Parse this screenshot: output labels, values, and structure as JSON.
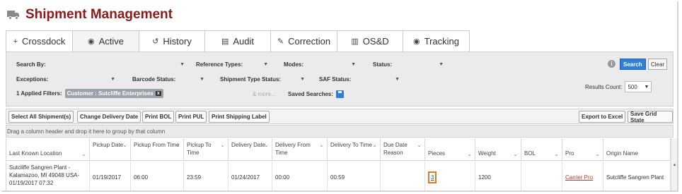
{
  "header": {
    "title": "Shipment Management",
    "icon": "truck-icon"
  },
  "tabs": [
    {
      "label": "Crossdock",
      "icon": "plus-icon",
      "glyph": "+"
    },
    {
      "label": "Active",
      "icon": "circle-dot-icon",
      "glyph": "◉"
    },
    {
      "label": "History",
      "icon": "history-icon",
      "glyph": "↺"
    },
    {
      "label": "Audit",
      "icon": "clipboard-icon",
      "glyph": "▤"
    },
    {
      "label": "Correction",
      "icon": "pencil-icon",
      "glyph": "✎"
    },
    {
      "label": "OS&D",
      "icon": "barcode-icon",
      "glyph": "▥"
    },
    {
      "label": "Tracking",
      "icon": "circle-dot-icon",
      "glyph": "◉"
    }
  ],
  "filters": {
    "search_by": "Search By:",
    "reference_types": "Reference Types:",
    "modes": "Modes:",
    "status": "Status:",
    "exceptions": "Exceptions:",
    "barcode_status": "Barcode Status:",
    "shipment_type_status": "Shipment Type Status:",
    "saf_status": "SAF Status:",
    "applied_label": "1 Applied Filters:",
    "applied_chip": "Customer : Sutcliffe Enterprises",
    "chip_close": "x",
    "more": "& more...",
    "saved_searches": "Saved Searches:",
    "search_button": "Search",
    "clear_button": "Clear",
    "results_count_label": "Results Count:",
    "results_count_value": "500"
  },
  "toolbar": {
    "select_all": "Select All Shipment(s)",
    "change_delivery_date": "Change Delivery Date",
    "print_bol": "Print BOL",
    "print_pul": "Print PUL",
    "print_shipping_label": "Print Shipping Label",
    "export_excel": "Export to Excel",
    "save_grid_state": "Save Grid State"
  },
  "group_hint": "Drag a column header and drop it here to group by that column",
  "grid": {
    "columns": [
      "Last Known Location",
      "Pickup Date",
      "Pickup From Time",
      "Pickup To Time",
      "Delivery Date",
      "Delivery From Time",
      "Delivery To Time",
      "Due Date Reason",
      "Pieces",
      "Weight",
      "BOL",
      "Pro",
      "Origin Name"
    ],
    "rows": [
      {
        "last_known_location": "Sutcliffe Sangren Plant - Kalamazoo, MI 49048 USA- 01/19/2017 07:32",
        "pickup_date": "01/19/2017",
        "pickup_from_time": "06:00",
        "pickup_to_time": "23:59",
        "delivery_date": "01/24/2017",
        "delivery_from_time": "00:00",
        "delivery_to_time": "00:59",
        "due_date_reason": "",
        "pieces": "3",
        "weight": "1200",
        "bol": "",
        "pro": "Carrier Pro",
        "origin_name": "Sutcliffe Sangren Plant"
      }
    ]
  }
}
